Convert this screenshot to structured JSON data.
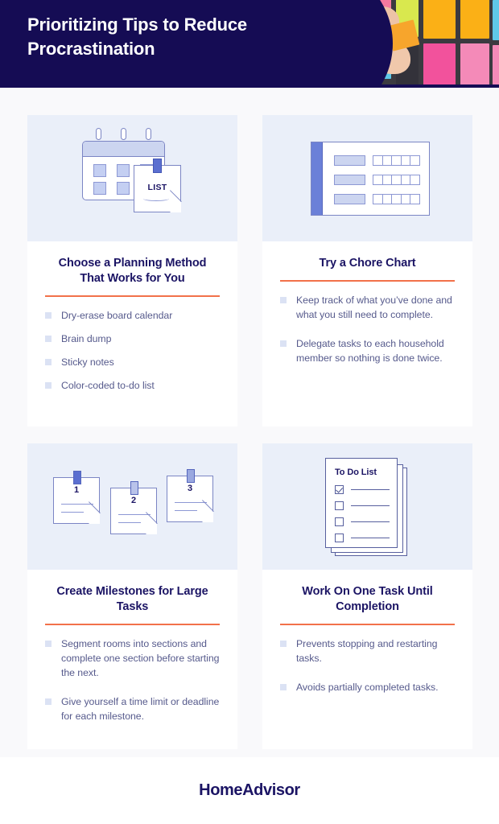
{
  "header": {
    "title": "Prioritizing Tips to Reduce Procrastination",
    "background_color": "#150c54",
    "text_color": "#ffffff",
    "photo_alt": "Hands placing an orange sticky note on a dark board covered in colorful sticky notes"
  },
  "theme": {
    "page_background": "#f9f9fb",
    "card_background": "#ffffff",
    "icon_panel_background": "#eaeff9",
    "accent_rule": "#f2714a",
    "heading_color": "#1b1464",
    "body_text_color": "#565a8c",
    "bullet_marker_color": "#dbe2f4",
    "icon_blue": "#6b80d8",
    "icon_light_blue": "#ccd5f0",
    "icon_outline": "#7b85c4"
  },
  "cards": [
    {
      "id": "planning-method",
      "icon_name": "calendar-with-list-note-icon",
      "icon": {
        "note_label": "LIST",
        "calendar_cells": 6,
        "rings": 3
      },
      "title": "Choose a Planning Method That Works for You",
      "bullets": [
        "Dry-erase board calendar",
        "Brain dump",
        "Sticky notes",
        "Color-coded to-do list"
      ],
      "bullet_spacing": "tight"
    },
    {
      "id": "chore-chart",
      "icon_name": "chore-chart-icon",
      "icon": {
        "rows": 3,
        "cells_per_row": 5
      },
      "title": "Try a Chore Chart",
      "bullets": [
        "Keep track of what you’ve done and what you still need to complete.",
        "Delegate tasks to each household member so nothing is done twice."
      ],
      "bullet_spacing": "loose"
    },
    {
      "id": "create-milestones",
      "icon_name": "numbered-sticky-notes-icon",
      "icon": {
        "note_numbers": [
          "1",
          "2",
          "3"
        ]
      },
      "title": "Create Milestones for Large Tasks",
      "bullets": [
        "Segment rooms into sections and complete one section before starting the next.",
        "Give yourself a time limit or deadline for each milestone."
      ],
      "bullet_spacing": "loose"
    },
    {
      "id": "one-task-until-completion",
      "icon_name": "to-do-list-stack-icon",
      "icon": {
        "list_title": "To Do List",
        "checkbox_rows": 4,
        "checked_rows": [
          0
        ]
      },
      "title": "Work On One Task Until Completion",
      "bullets": [
        "Prevents stopping and restarting tasks.",
        "Avoids partially completed tasks."
      ],
      "bullet_spacing": "loose"
    }
  ],
  "footer": {
    "logo": "HomeAdvisor"
  }
}
